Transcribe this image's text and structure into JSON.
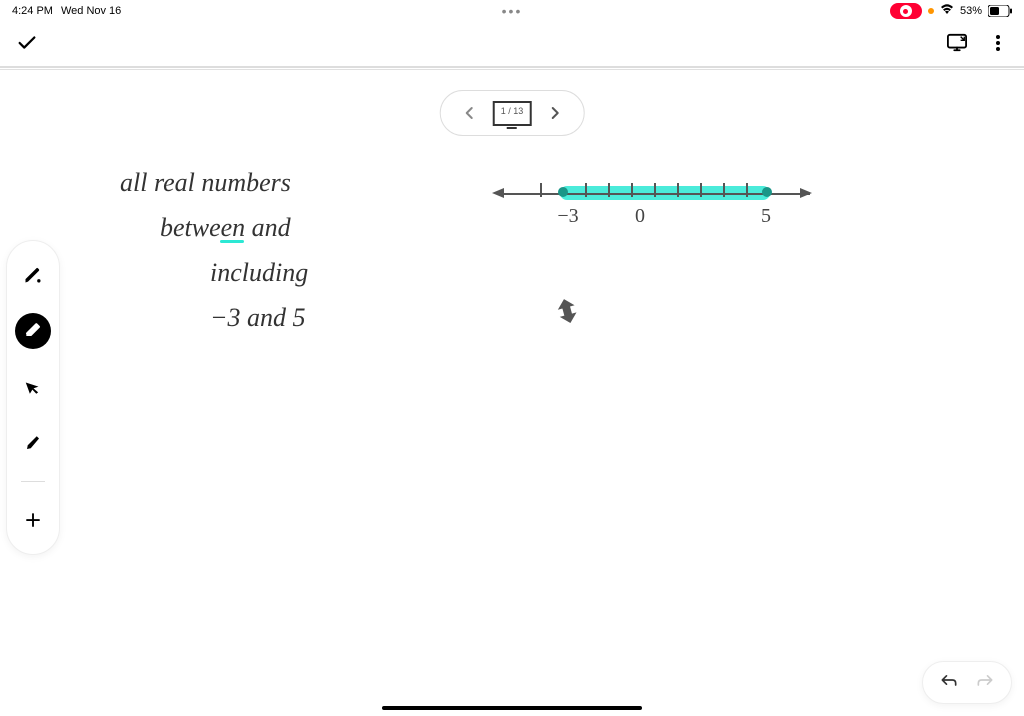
{
  "statusBar": {
    "time": "4:24 PM",
    "date": "Wed Nov 16",
    "batteryPercent": "53%"
  },
  "pageNav": {
    "current": "1",
    "total": "13",
    "separator": " / "
  },
  "handwriting": {
    "line1": "all real numbers",
    "line2": "between and",
    "line3": "including",
    "line4": "−3 and 5"
  },
  "numberLine": {
    "leftLabel": "−3",
    "midLabel": "0",
    "rightLabel": "5",
    "leftEndpoint": -3,
    "rightEndpoint": 5,
    "highlightClosed": true
  },
  "tools": {
    "pen": "pen-tool",
    "eraser": "eraser-tool",
    "pointer": "pointer-tool",
    "shape": "highlighter-tool",
    "add": "add-tool"
  }
}
